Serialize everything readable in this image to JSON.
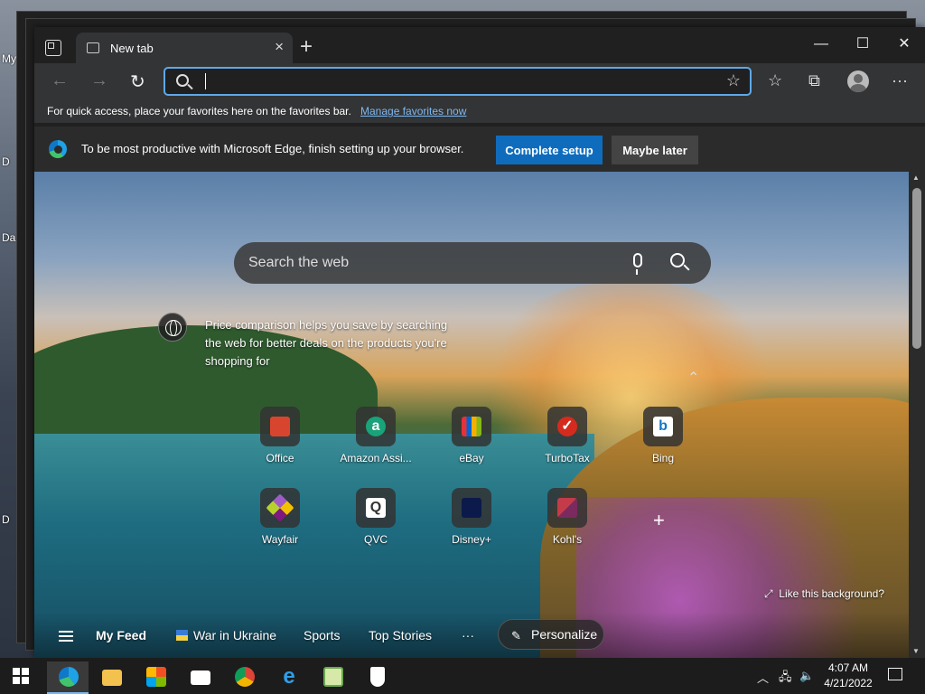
{
  "desktop": {
    "labels": [
      "My",
      "D",
      "Da",
      "D"
    ]
  },
  "tabs": [
    {
      "title": "New tab",
      "close_icon": "close-icon"
    }
  ],
  "window_controls": {
    "minimize": "—",
    "maximize": "☐",
    "close": "✕"
  },
  "address_bar": {
    "value": "",
    "placeholder": ""
  },
  "favorites_bar": {
    "text": "For quick access, place your favorites here on the favorites bar.",
    "link": "Manage favorites now"
  },
  "setup_banner": {
    "text": "To be most productive with Microsoft Edge, finish setting up your browser.",
    "primary_button": "Complete setup",
    "secondary_button": "Maybe later"
  },
  "web_search": {
    "placeholder": "Search the web"
  },
  "tip": {
    "text": "Price comparison helps you save by searching the web for better deals on the products you're shopping for"
  },
  "quick_links": [
    {
      "label": "Office",
      "color": "#d8452e",
      "glyph": ""
    },
    {
      "label": "Amazon Assi...",
      "color": "#1aa37a",
      "glyph": "a"
    },
    {
      "label": "eBay",
      "color": "#e53238",
      "glyph": ""
    },
    {
      "label": "TurboTax",
      "color": "#d52b1e",
      "glyph": "✓"
    },
    {
      "label": "Bing",
      "color": "#ffffff",
      "glyph": "b"
    },
    {
      "label": "Wayfair",
      "color": "#7f187f",
      "glyph": ""
    },
    {
      "label": "QVC",
      "color": "#ffffff",
      "glyph": "Q"
    },
    {
      "label": "Disney+",
      "color": "#0b1a4a",
      "glyph": ""
    },
    {
      "label": "Kohl's",
      "color": "#c43b4a",
      "glyph": ""
    }
  ],
  "like_background": "Like this background?",
  "feed": {
    "my_feed": "My Feed",
    "war_in_ukraine": "War in Ukraine",
    "sports": "Sports",
    "top_stories": "Top Stories",
    "more": "···",
    "personalize": "Personalize"
  },
  "clock": {
    "time": "4:07 AM",
    "date": "4/21/2022"
  },
  "colors": {
    "accent": "#0f6cbd",
    "link": "#7db8f0",
    "address_focus": "#5fa8e8"
  }
}
